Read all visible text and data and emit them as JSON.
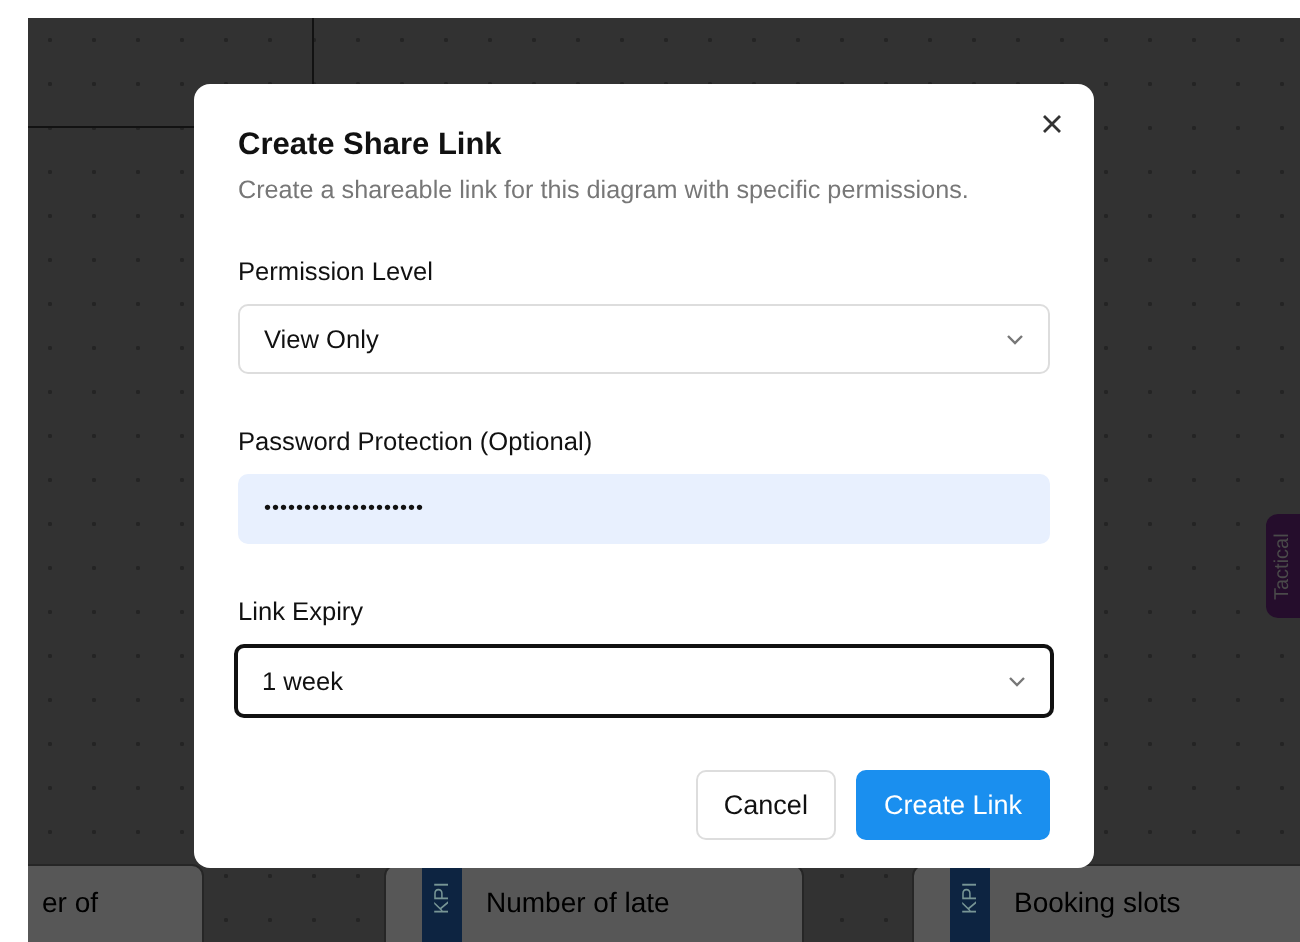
{
  "canvas": {
    "cards": [
      {
        "title": "er of"
      },
      {
        "tag": "KPI",
        "title": "Number of late"
      },
      {
        "tag": "KPI",
        "title": "Booking slots"
      }
    ],
    "side_tag": "Tactical"
  },
  "dialog": {
    "title": "Create Share Link",
    "subtitle": "Create a shareable link for this diagram with specific permissions.",
    "fields": [
      {
        "kind": "select",
        "label": "Permission Level",
        "value": "View Only",
        "focused": false
      },
      {
        "kind": "password",
        "label": "Password Protection (Optional)",
        "value": "••••••••••••••••••••",
        "focused": false
      },
      {
        "kind": "select",
        "label": "Link Expiry",
        "value": "1 week",
        "focused": true
      }
    ],
    "buttons": [
      {
        "label": "Cancel",
        "kind": "secondary"
      },
      {
        "label": "Create Link",
        "kind": "primary"
      }
    ]
  }
}
